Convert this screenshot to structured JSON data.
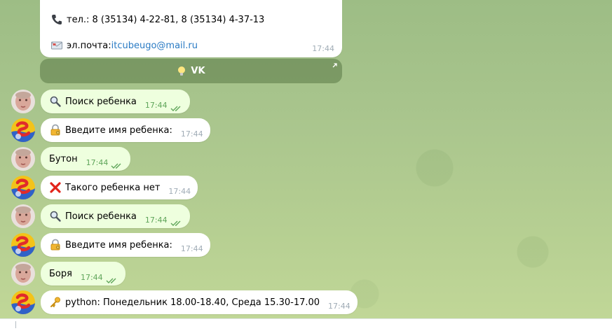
{
  "top_message": {
    "phone_icon": "telephone-receiver-icon",
    "phone_text": "тел.: 8 (35134) 4-22-81, 8 (35134) 4-37-13",
    "email_icon": "envelope-icon",
    "email_prefix": "эл.почта: ",
    "email_link": "itcubeugo@mail.ru",
    "time": "17:44",
    "button_icon": "light-bulb-icon",
    "button_label": "VK"
  },
  "messages": [
    {
      "sender": "user",
      "icon": "magnifier-icon",
      "text": "Поиск ребенка",
      "time": "17:44",
      "read": true
    },
    {
      "sender": "bot",
      "icon": "lock-key-icon",
      "text": "Введите имя ребенка:",
      "time": "17:44"
    },
    {
      "sender": "user",
      "icon": "",
      "text": "Бутон",
      "time": "17:44",
      "read": true
    },
    {
      "sender": "bot",
      "icon": "red-cross-icon",
      "text": "Такого ребенка нет",
      "time": "17:44"
    },
    {
      "sender": "user",
      "icon": "magnifier-icon",
      "text": "Поиск ребенка",
      "time": "17:44",
      "read": true
    },
    {
      "sender": "bot",
      "icon": "lock-key-icon",
      "text": "Введите имя ребенка:",
      "time": "17:44"
    },
    {
      "sender": "user",
      "icon": "",
      "text": "Боря",
      "time": "17:44",
      "read": true
    },
    {
      "sender": "bot",
      "icon": "key-icon",
      "text": "python: Понедельник 18.00-18.40, Среда 15.30-17.00",
      "time": "17:44"
    }
  ],
  "colors": {
    "incoming_bubble": "#ffffff",
    "outgoing_bubble": "#eeffde",
    "link": "#2a7bc4",
    "read_checks": "#5fa55a"
  }
}
